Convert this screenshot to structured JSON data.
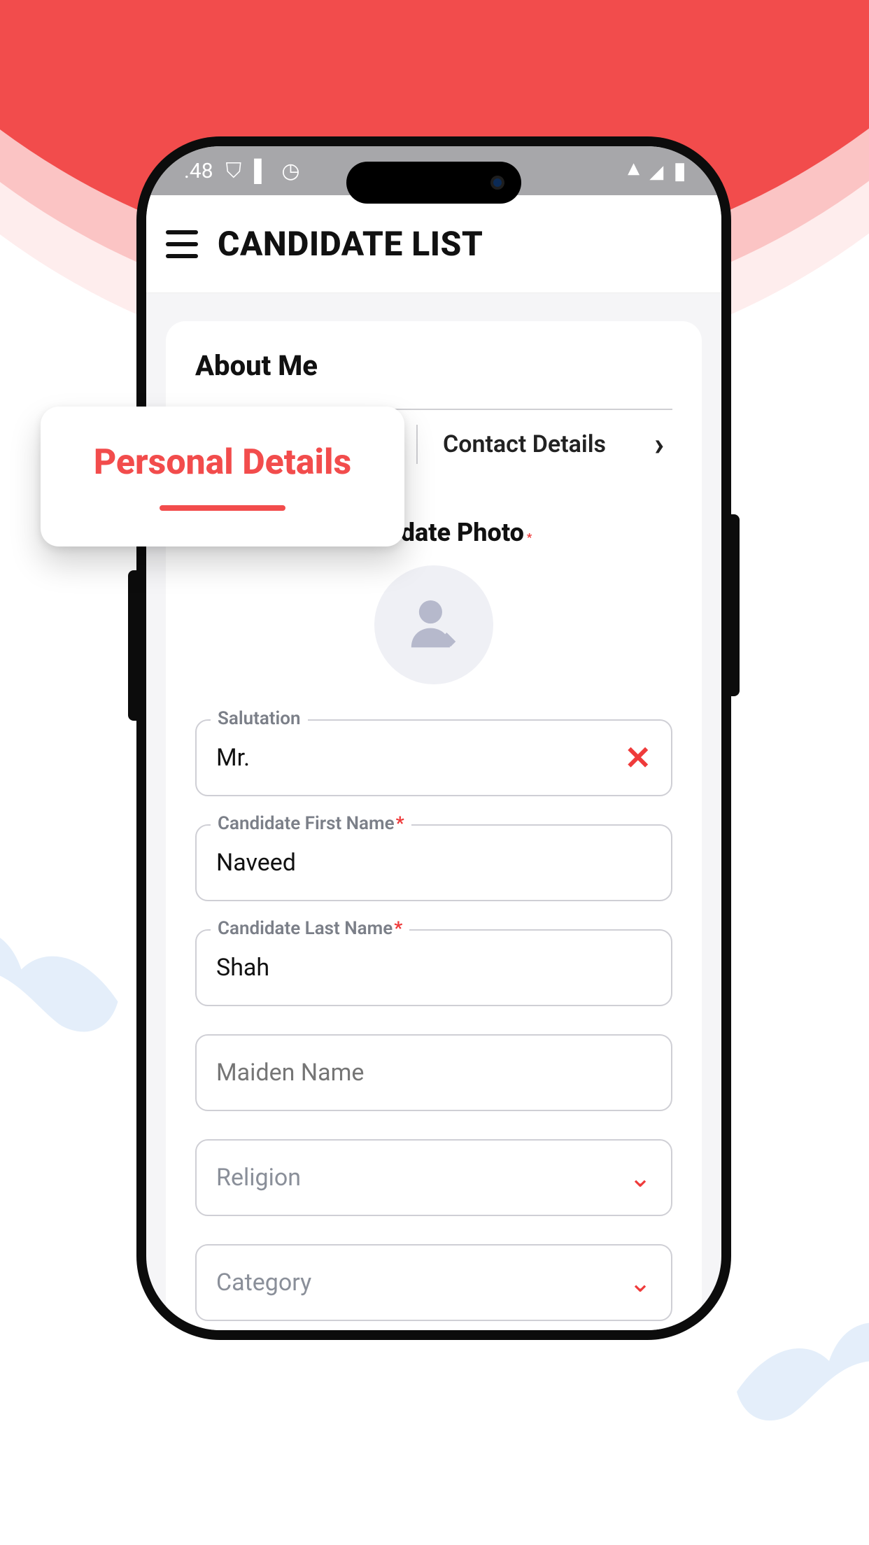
{
  "statusbar": {
    "time_partial": ".48"
  },
  "appbar": {
    "title": "CANDIDATE LIST"
  },
  "section_title": "About Me",
  "tabs": {
    "active": "Personal Details",
    "other": "Contact Details"
  },
  "photo": {
    "label": "Candidate Photo"
  },
  "fields": {
    "salutation": {
      "label": "Salutation",
      "value": "Mr."
    },
    "first_name": {
      "label": "Candidate First Name",
      "value": "Naveed"
    },
    "last_name": {
      "label": "Candidate Last Name",
      "value": "Shah"
    },
    "maiden_name": {
      "placeholder": "Maiden Name",
      "value": ""
    },
    "religion": {
      "placeholder": "Religion",
      "value": ""
    },
    "category": {
      "placeholder": "Category",
      "value": ""
    }
  },
  "colors": {
    "accent": "#f24c4c"
  }
}
